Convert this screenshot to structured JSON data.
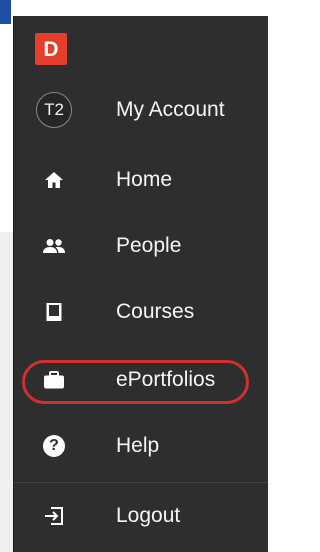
{
  "app": {
    "logo_letter": "D",
    "brand_color": "#e53e2d"
  },
  "account": {
    "avatar_initials": "T2",
    "label": "My Account"
  },
  "nav": {
    "items": [
      {
        "label": "Home",
        "icon": "home-icon"
      },
      {
        "label": "People",
        "icon": "people-icon"
      },
      {
        "label": "Courses",
        "icon": "book-icon"
      },
      {
        "label": "ePortfolios",
        "icon": "briefcase-icon",
        "highlighted": true
      },
      {
        "label": "Help",
        "icon": "help-icon"
      },
      {
        "label": "Logout",
        "icon": "logout-icon"
      }
    ]
  },
  "colors": {
    "sidebar_bg": "#2e2e2e",
    "highlight": "#d32f2f"
  }
}
